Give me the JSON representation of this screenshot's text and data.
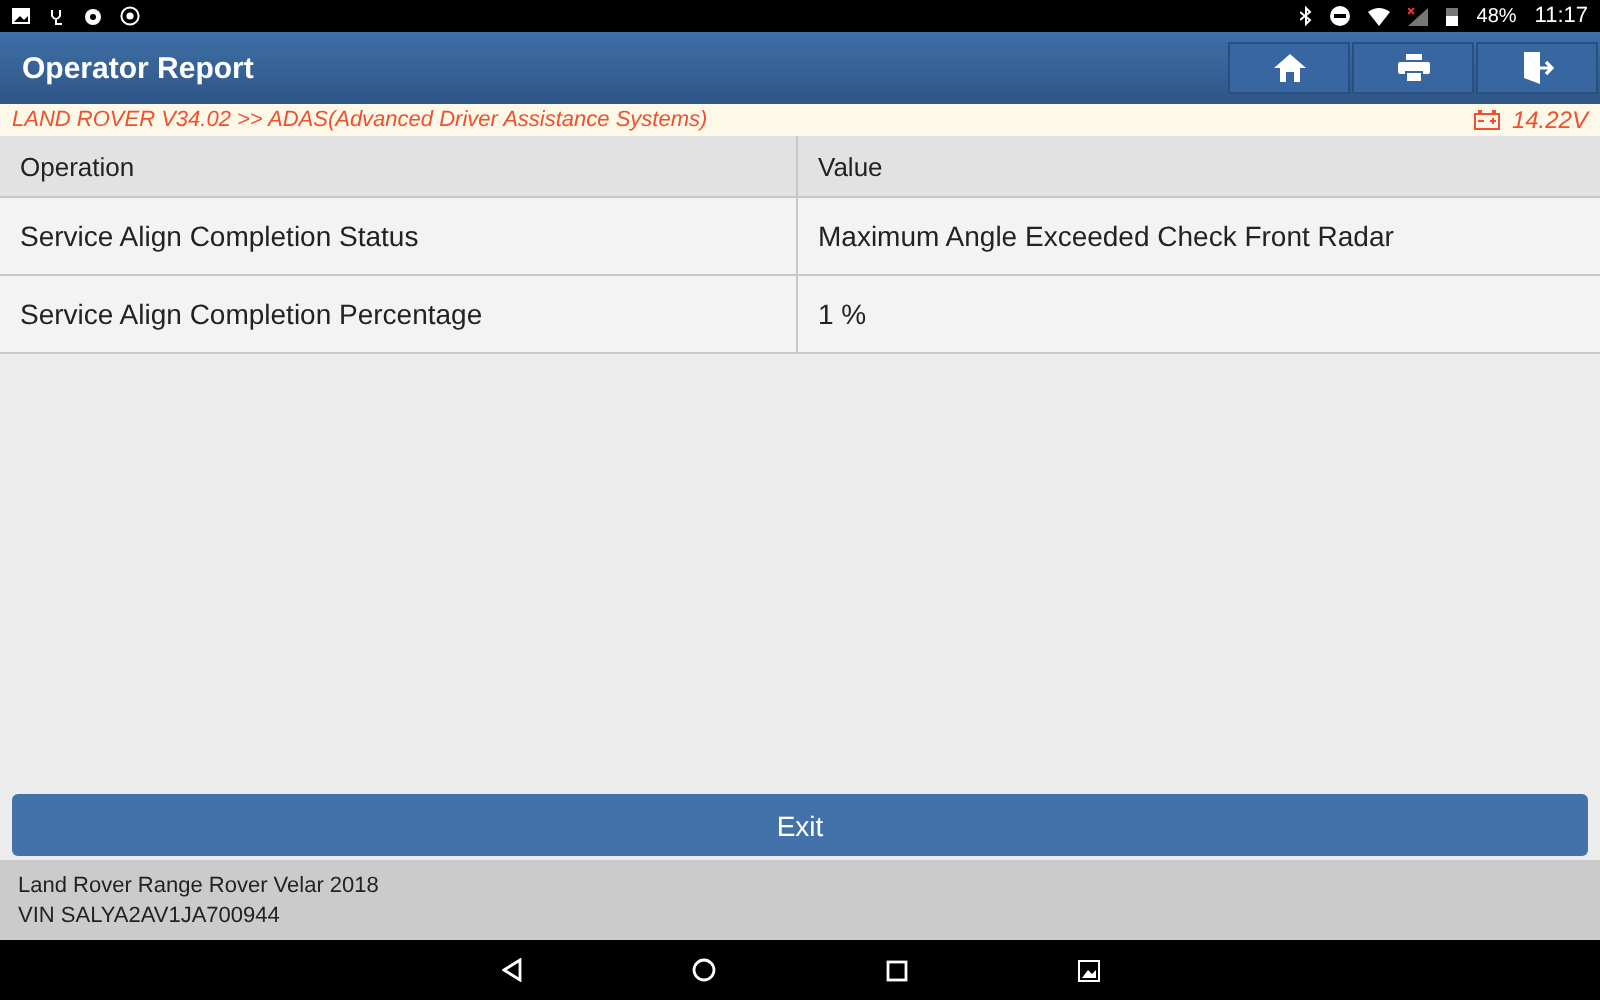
{
  "status_bar": {
    "battery": "48%",
    "time": "11:17"
  },
  "header": {
    "title": "Operator Report"
  },
  "breadcrumb": {
    "path": "LAND ROVER V34.02 >> ADAS(Advanced Driver Assistance Systems)",
    "voltage": "14.22V"
  },
  "table": {
    "columns": [
      "Operation",
      "Value"
    ],
    "rows": [
      {
        "operation": "Service Align Completion Status",
        "value": "Maximum Angle Exceeded Check Front Radar"
      },
      {
        "operation": "Service Align Completion Percentage",
        "value": "1 %"
      }
    ]
  },
  "exit_button": "Exit",
  "footer": {
    "vehicle": "Land Rover Range Rover Velar 2018",
    "vin": "VIN SALYA2AV1JA700944"
  }
}
